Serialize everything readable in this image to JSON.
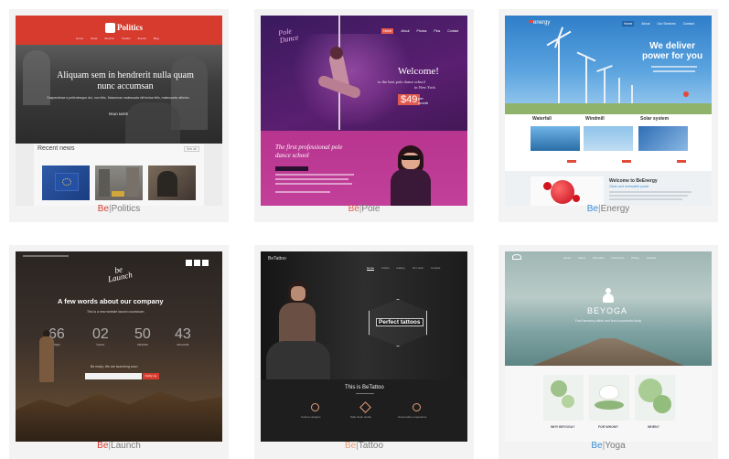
{
  "themes": [
    {
      "prefix": "Be",
      "sep": "|",
      "name": "Politics",
      "accent": "#d63b2e",
      "logo": "Politics",
      "nav": [
        "Home",
        "News",
        "Election",
        "Parties",
        "Events",
        "Blog"
      ],
      "headline": "Aliquam sem in hendrerit nulla quam nunc accumsan",
      "sub": "Suspendisse a pellentesque dui, non felis. Maecenas malesuada elit lectus felis, malesuada ultricies.",
      "cta": "READ MORE",
      "news_title": "Recent news",
      "news_btn": "See all"
    },
    {
      "prefix": "Be",
      "sep": "|",
      "name": "Pole",
      "accent": "#e05a4e",
      "logo_line1": "Pole",
      "logo_line2": "Dance",
      "nav": [
        "Home",
        "About",
        "Photos",
        "Plus",
        "Contact"
      ],
      "welcome": "Welcome!",
      "welcome_sub_1": "to the best pole dance school",
      "welcome_sub_2": "in New York",
      "price": "$49",
      "price_unit_1": "per",
      "price_unit_2": "month",
      "promo": "The first professional pole dance school"
    },
    {
      "prefix": "Be",
      "sep": "|",
      "name": "Energy",
      "accent": "#3b8fd6",
      "logo": "energy",
      "nav": [
        "Home",
        "About",
        "Our Services",
        "Contact"
      ],
      "headline_1": "We deliver",
      "headline_2": "power for you",
      "features": [
        "Waterfall",
        "Windmill",
        "Solar system"
      ],
      "welcome": "Welcome to BeEnergy",
      "welcome_sub": "Clean and renewable power"
    },
    {
      "prefix": "Be",
      "sep": "|",
      "name": "Launch",
      "accent": "#d63b2e",
      "logo_line1": "be",
      "logo_line2": "Launch",
      "headline": "A few words about our company",
      "sub": "This is a new website launch countdown",
      "countdown": [
        {
          "value": "66",
          "unit": "days"
        },
        {
          "value": "02",
          "unit": "hours"
        },
        {
          "value": "50",
          "unit": "minutes"
        },
        {
          "value": "43",
          "unit": "seconds"
        }
      ],
      "notify": "Be ready, We are launching soon",
      "cta": "Notify me"
    },
    {
      "prefix": "Be",
      "sep": "|",
      "name": "Tattoo",
      "accent": "#e8a07a",
      "logo": "BeTattoo",
      "nav": [
        "Home",
        "Artists",
        "Gallery",
        "Our work",
        "Contact"
      ],
      "badge": "Perfect tattoos",
      "headline": "This is BeTattoo",
      "features": [
        "Custom designs",
        "Safe clean studio",
        "Great tattoo experience"
      ]
    },
    {
      "prefix": "Be",
      "sep": "|",
      "name": "Yoga",
      "accent": "#3b8fd6",
      "logo": "BEYOGA",
      "nav": [
        "Home",
        "About",
        "Schedule",
        "Instructors",
        "Prices",
        "Contact"
      ],
      "tagline": "Find harmony within and find a wonderful body",
      "features": [
        "WHY BEYOGA?",
        "FOR WHOM?",
        "WHEN?"
      ]
    }
  ]
}
